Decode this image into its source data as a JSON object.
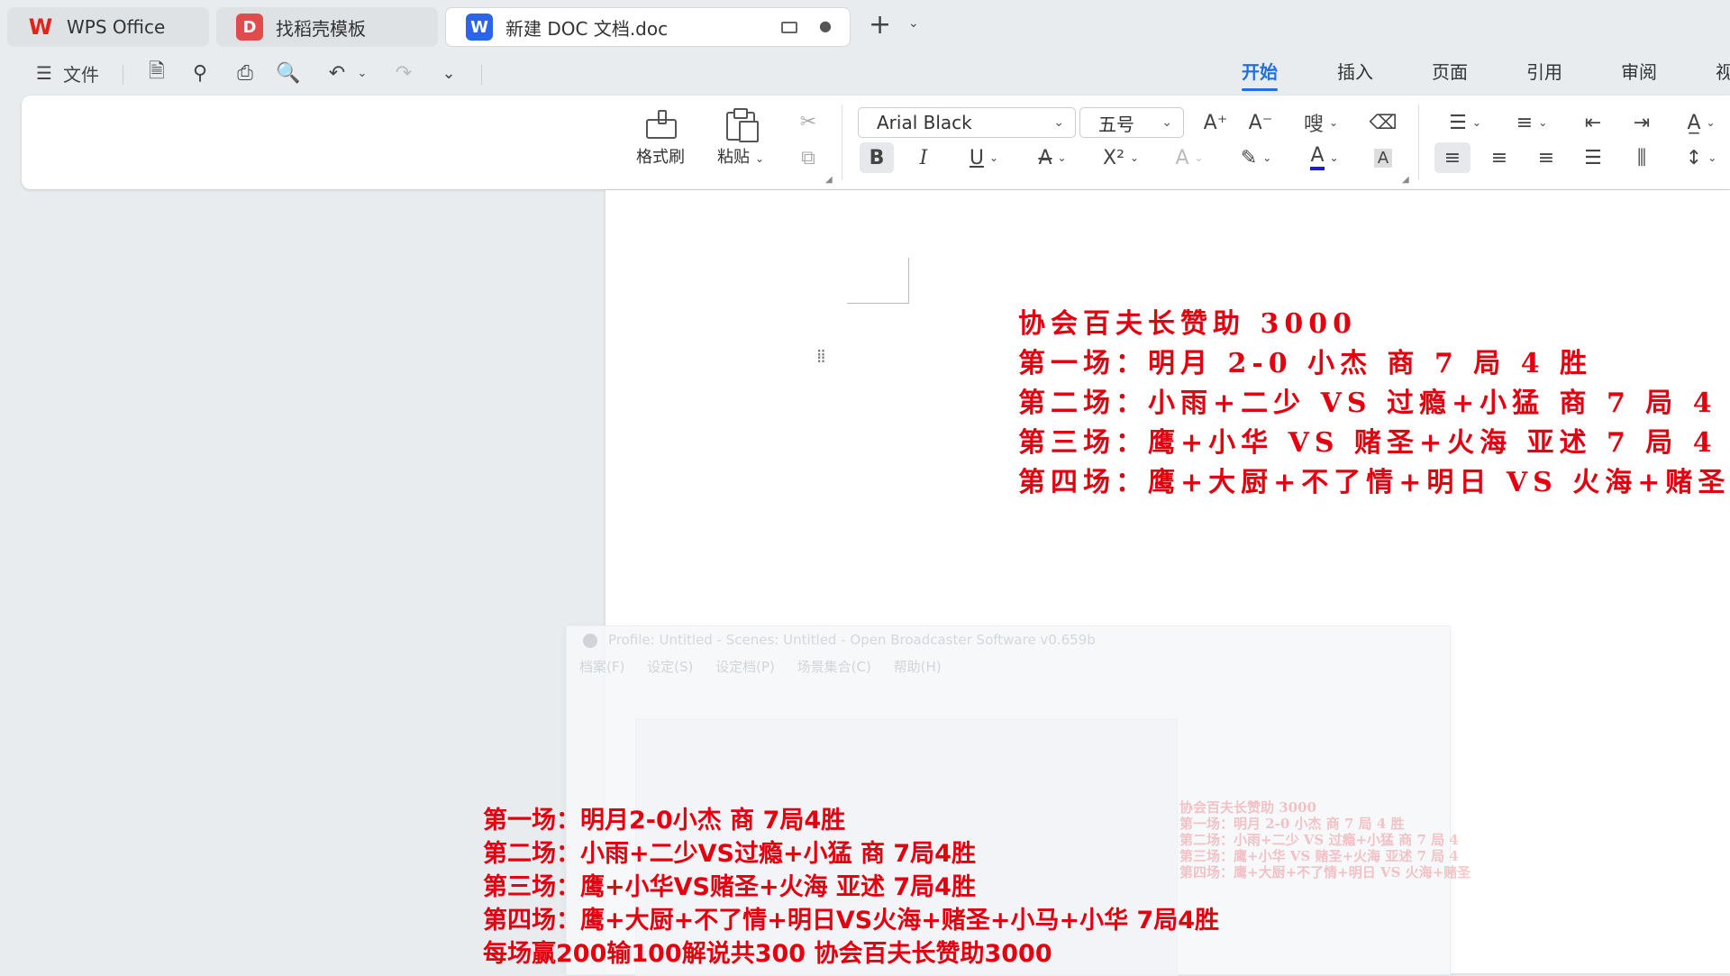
{
  "tabs": [
    {
      "label": "WPS Office",
      "icon": "wps-logo-icon",
      "color": "#e2231a"
    },
    {
      "label": "找稻壳模板",
      "icon": "docer-icon",
      "color": "#e24b4b"
    },
    {
      "label": "新建 DOC 文档.doc",
      "icon": "word-doc-icon",
      "color": "#2b64e8"
    }
  ],
  "menu": {
    "file_label": "文件",
    "tabs": [
      "开始",
      "插入",
      "页面",
      "引用",
      "审阅",
      "视"
    ],
    "active_tab": "开始"
  },
  "ribbon": {
    "format_painter": "格式刷",
    "paste": "粘贴",
    "font_name": "Arial Black",
    "font_size": "五号",
    "font_color": "#1a1adb",
    "accent_color": "#1f6fe5"
  },
  "document": {
    "text_color": "#e3000f",
    "lines": [
      "协会百夫长赞助 3000",
      "第一场：明月 2-0 小杰  商 7 局 4 胜",
      "第二场：小雨+二少 VS 过瘾+小猛  商 7 局 4",
      "第三场：鹰+小华 VS 赌圣+火海  亚述 7 局 4",
      "第四场：鹰+大厨+不了情+明日 VS 火海+赌圣"
    ]
  },
  "ghost_window": {
    "title": "Profile: Untitled - Scenes: Untitled - Open Broadcaster Software v0.659b",
    "menu": [
      "档案(F)",
      "设定(S)",
      "设定档(P)",
      "场景集合(C)",
      "帮助(H)"
    ]
  },
  "subtitles": [
    "第一场：明月2-0小杰  商 7局4胜",
    "第二场：小雨+二少VS过瘾+小猛  商 7局4胜",
    "第三场：鹰+小华VS赌圣+火海 亚述 7局4胜",
    "第四场：鹰+大厨+不了情+明日VS火海+赌圣+小马+小华  7局4胜",
    "每场赢200输100解说共300 协会百夫长赞助3000"
  ]
}
